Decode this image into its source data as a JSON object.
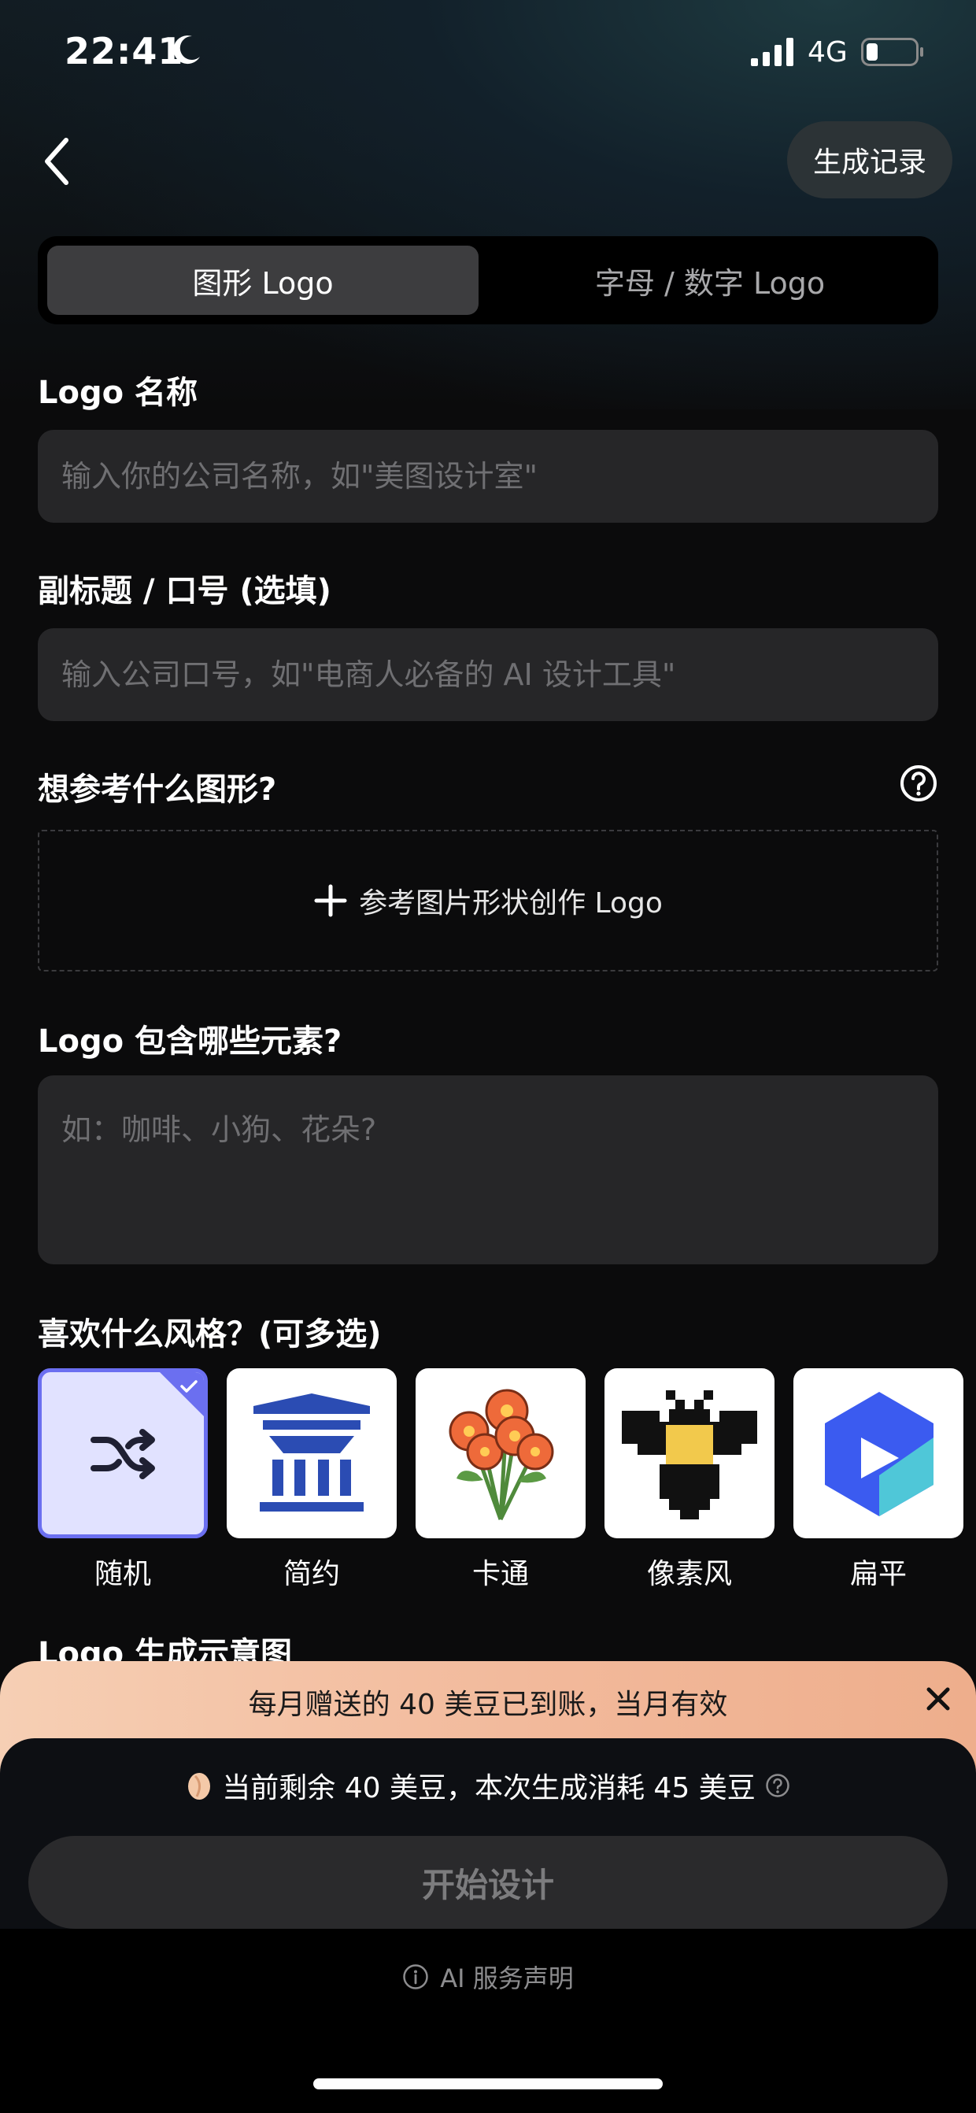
{
  "status_bar": {
    "time": "22:41",
    "network": "4G",
    "icons": [
      "moon-icon",
      "signal-icon",
      "battery-icon"
    ]
  },
  "header": {
    "back_icon": "chevron-left-icon",
    "history_label": "生成记录"
  },
  "tabs": [
    {
      "label": "图形 Logo",
      "active": true
    },
    {
      "label": "字母 / 数字 Logo",
      "active": false
    }
  ],
  "form": {
    "name_label": "Logo 名称",
    "name_placeholder": "输入你的公司名称，如\"美图设计室\"",
    "subtitle_label": "副标题 / 口号 (选填)",
    "subtitle_placeholder": "输入公司口号，如\"电商人必备的 AI 设计工具\"",
    "reference_label": "想参考什么图形?",
    "reference_upload": "参考图片形状创作 Logo",
    "elements_label": "Logo 包含哪些元素?",
    "elements_placeholder": "如：咖啡、小狗、花朵?",
    "style_label": "喜欢什么风格？(可多选)",
    "styles": [
      {
        "label": "随机",
        "selected": true,
        "icon": "shuffle-icon"
      },
      {
        "label": "简约",
        "selected": false,
        "icon": "building-icon"
      },
      {
        "label": "卡通",
        "selected": false,
        "icon": "flowers-icon"
      },
      {
        "label": "像素风",
        "selected": false,
        "icon": "pixel-bee-icon"
      },
      {
        "label": "扁平",
        "selected": false,
        "icon": "flat-logo-icon"
      }
    ],
    "preview_label": "Logo 生成示意图"
  },
  "promo": {
    "text": "每月赠送的 40 美豆已到账，当月有效"
  },
  "footer": {
    "beans_text": "当前剩余 40 美豆，本次生成消耗 45 美豆",
    "start_button": "开始设计",
    "ai_notice": "AI 服务声明"
  },
  "colors": {
    "accent": "#6b6ff0",
    "field_bg": "#262628",
    "promo_start": "#f6cfb4",
    "promo_end": "#eeae8c"
  }
}
